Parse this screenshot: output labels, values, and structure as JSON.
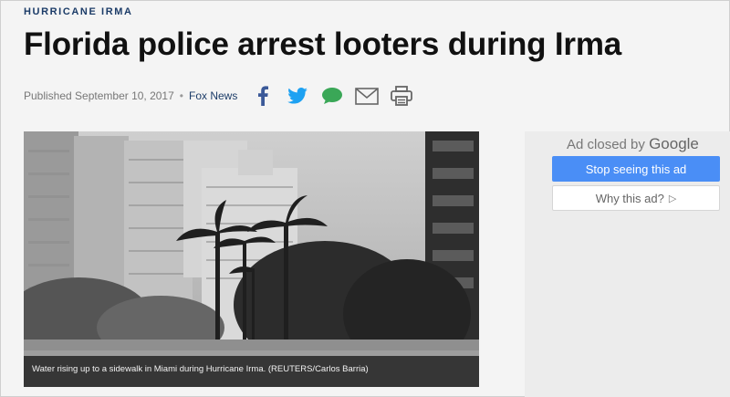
{
  "article": {
    "kicker": "HURRICANE IRMA",
    "headline": "Florida police arrest looters during Irma",
    "published": "Published September 10, 2017",
    "separator": "•",
    "source": "Fox News"
  },
  "share": {
    "icons": [
      "facebook-icon",
      "twitter-icon",
      "comment-icon",
      "email-icon",
      "print-icon"
    ],
    "colors": {
      "facebook": "#3b5998",
      "twitter": "#1da1f2",
      "comment": "#3aa757",
      "email": "#666666",
      "print": "#666666"
    }
  },
  "photo": {
    "caption": "Water rising up to a sidewalk in Miami during Hurricane Irma.  (REUTERS/Carlos Barria)"
  },
  "ad": {
    "closed_by": "Ad closed by",
    "google": "Google",
    "stop_label": "Stop seeing this ad",
    "why_label": "Why this ad?",
    "why_icon": "▷",
    "stop_color": "#4a8ef6"
  }
}
